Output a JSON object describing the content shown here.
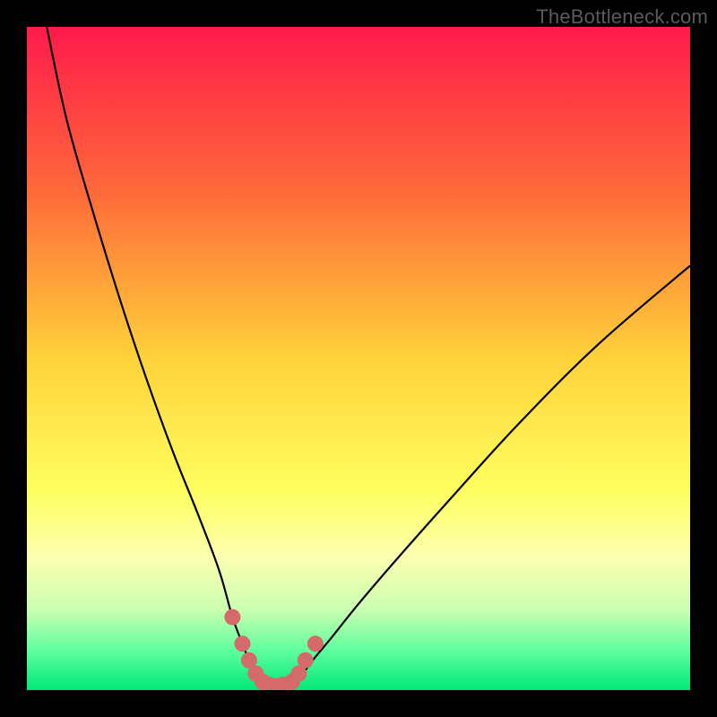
{
  "watermark": "TheBottleneck.com",
  "chart_data": {
    "type": "line",
    "title": "",
    "xlabel": "",
    "ylabel": "",
    "xlim": [
      0,
      100
    ],
    "ylim": [
      0,
      100
    ],
    "grid": false,
    "legend": false,
    "background_gradient": {
      "stops": [
        {
          "offset": 0.0,
          "color": "#ff1a4b"
        },
        {
          "offset": 0.25,
          "color": "#ff6a3a"
        },
        {
          "offset": 0.5,
          "color": "#ffd23a"
        },
        {
          "offset": 0.7,
          "color": "#ffff60"
        },
        {
          "offset": 0.8,
          "color": "#fcffb0"
        },
        {
          "offset": 0.88,
          "color": "#c9ffb0"
        },
        {
          "offset": 0.94,
          "color": "#5fff9e"
        },
        {
          "offset": 1.0,
          "color": "#00e878"
        }
      ]
    },
    "series": [
      {
        "name": "left-curve",
        "x": [
          3,
          6,
          10,
          14,
          18,
          22,
          26,
          29,
          31,
          32.5,
          33.5,
          34.5,
          35,
          35.5
        ],
        "y": [
          100,
          86,
          72,
          59,
          47,
          36,
          26,
          18,
          11,
          7,
          4.5,
          2.5,
          1.3,
          0.6
        ]
      },
      {
        "name": "right-curve",
        "x": [
          40.5,
          41,
          42,
          43.5,
          46,
          50,
          56,
          64,
          74,
          86,
          100
        ],
        "y": [
          0.6,
          1.3,
          3,
          5,
          8,
          13,
          20,
          29,
          40,
          52,
          64
        ]
      },
      {
        "name": "bottom-markers",
        "x": [
          31,
          32.5,
          33.5,
          34.5,
          35.5,
          36.5,
          37.5,
          38.5,
          40,
          41,
          42,
          43.5
        ],
        "y": [
          11,
          7,
          4.5,
          2.5,
          1.3,
          0.8,
          0.6,
          0.8,
          1.3,
          2.5,
          4.5,
          7
        ]
      }
    ],
    "marker_style": {
      "radius_px": 9,
      "fill": "#d46a6a"
    }
  }
}
